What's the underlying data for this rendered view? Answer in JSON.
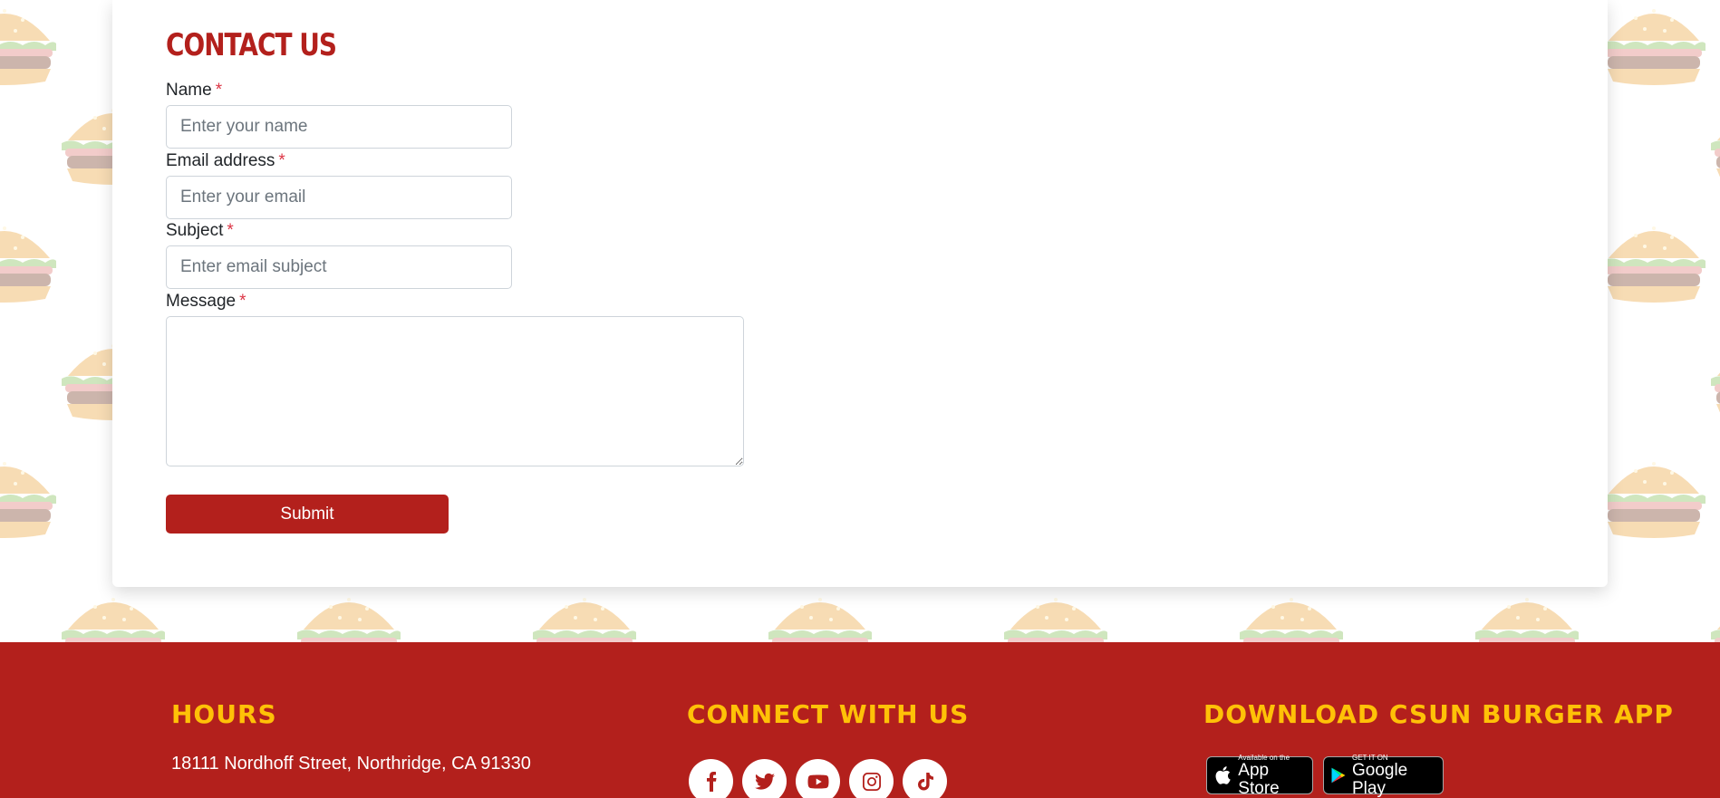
{
  "contact": {
    "title": "Contact Us",
    "required_mark": "*",
    "name_label": "Name",
    "name_placeholder": "Enter your name",
    "email_label": "Email address",
    "email_placeholder": "Enter your email",
    "subject_label": "Subject",
    "subject_placeholder": "Enter email subject",
    "message_label": "Message",
    "message_value": "",
    "submit_label": "Submit"
  },
  "footer": {
    "hours_heading": "HOURS",
    "address": "18111 Nordhoff Street, Northridge, CA 91330",
    "connect_heading": "CONNECT WITH US",
    "socials": [
      "facebook-icon",
      "twitter-icon",
      "youtube-icon",
      "instagram-icon",
      "tiktok-icon"
    ],
    "app_heading": "DOWNLOAD CSUN BURGER APP",
    "app_store_small": "Available on the",
    "app_store_big": "App Store",
    "google_play_small": "GET IT ON",
    "google_play_big": "Google Play"
  },
  "colors": {
    "brand_red": "#b3201c",
    "accent_yellow": "#ffc107",
    "required_red": "#dc3545"
  }
}
